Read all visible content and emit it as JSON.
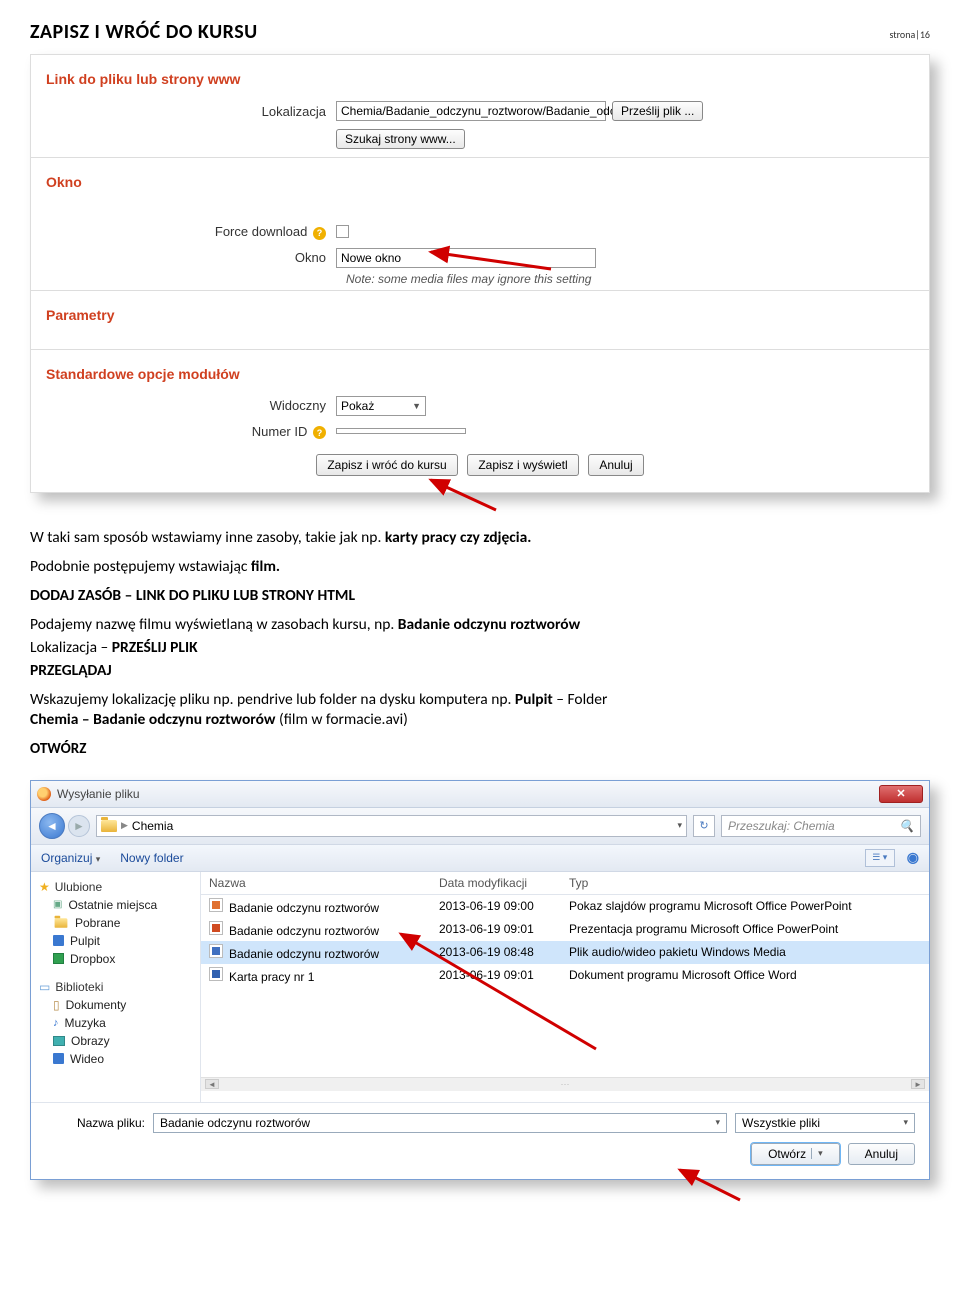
{
  "header": {
    "title": "ZAPISZ I WRÓĆ DO KURSU",
    "page_indicator": "strona|16"
  },
  "moodle": {
    "sections": {
      "link": "Link do pliku lub strony www",
      "window": "Okno",
      "params": "Parametry",
      "std_opts": "Standardowe opcje modułów"
    },
    "labels": {
      "location": "Lokalizacja",
      "force_download": "Force download",
      "window": "Okno",
      "visible": "Widoczny",
      "number_id": "Numer ID"
    },
    "values": {
      "location_path": "Chemia/Badanie_odczynu_roztworow/Badanie_odczyn",
      "window_select": "Nowe okno",
      "visible_select": "Pokaż"
    },
    "buttons": {
      "upload": "Prześlij plik ...",
      "search_www": "Szukaj strony www...",
      "save_return": "Zapisz i wróć do kursu",
      "save_display": "Zapisz i wyświetl",
      "cancel": "Anuluj"
    },
    "note": "Note: some media files may ignore this setting"
  },
  "body": {
    "p1_a": "W taki sam sposób wstawiamy inne zasoby, takie jak np. ",
    "p1_b": "karty pracy czy zdjęcia.",
    "p2_a": "Podobnie postępujemy wstawiając ",
    "p2_b": "film.",
    "h1": "DODAJ ZASÓB – LINK DO PLIKU LUB STRONY HTML",
    "p3_a": "Podajemy nazwę filmu wyświetlaną w zasobach kursu, np. ",
    "p3_b": "Badanie odczynu roztworów",
    "p4_a": "Lokalizacja – ",
    "p4_b": "PRZEŚLIJ PLIK",
    "p5": "PRZEGLĄDAJ",
    "p6_a": "Wskazujemy lokalizację pliku np. pendrive lub folder na dysku komputera np. ",
    "p6_b": "Pulpit",
    "p6_c": " – Folder ",
    "p6_d": "Chemia – Badanie odczynu roztworów",
    "p6_e": " (film w formacie.avi)",
    "h2": "OTWÓRZ"
  },
  "dialog": {
    "title": "Wysyłanie pliku",
    "breadcrumb": "Chemia",
    "search_placeholder": "Przeszukaj: Chemia",
    "toolbar": {
      "organize": "Organizuj",
      "new_folder": "Nowy folder"
    },
    "sidebar": {
      "favorites": "Ulubione",
      "recent": "Ostatnie miejsca",
      "downloads": "Pobrane",
      "desktop": "Pulpit",
      "dropbox": "Dropbox",
      "libraries": "Biblioteki",
      "documents": "Dokumenty",
      "music": "Muzyka",
      "pictures": "Obrazy",
      "videos": "Wideo"
    },
    "columns": {
      "name": "Nazwa",
      "date": "Data modyfikacji",
      "type": "Typ"
    },
    "files": [
      {
        "icon": "ppt",
        "name": "Badanie odczynu roztworów",
        "date": "2013-06-19 09:00",
        "type": "Pokaz slajdów programu Microsoft Office PowerPoint",
        "selected": false
      },
      {
        "icon": "pptx",
        "name": "Badanie odczynu roztworów",
        "date": "2013-06-19 09:01",
        "type": "Prezentacja programu Microsoft Office PowerPoint",
        "selected": false
      },
      {
        "icon": "wmv",
        "name": "Badanie odczynu roztworów",
        "date": "2013-06-19 08:48",
        "type": "Plik audio/wideo pakietu Windows Media",
        "selected": true
      },
      {
        "icon": "doc",
        "name": "Karta pracy nr 1",
        "date": "2013-06-19 09:01",
        "type": "Dokument programu Microsoft Office Word",
        "selected": false
      }
    ],
    "footer": {
      "filename_label": "Nazwa pliku:",
      "filename_value": "Badanie odczynu roztworów",
      "filter": "Wszystkie pliki",
      "open": "Otwórz",
      "cancel": "Anuluj"
    }
  }
}
